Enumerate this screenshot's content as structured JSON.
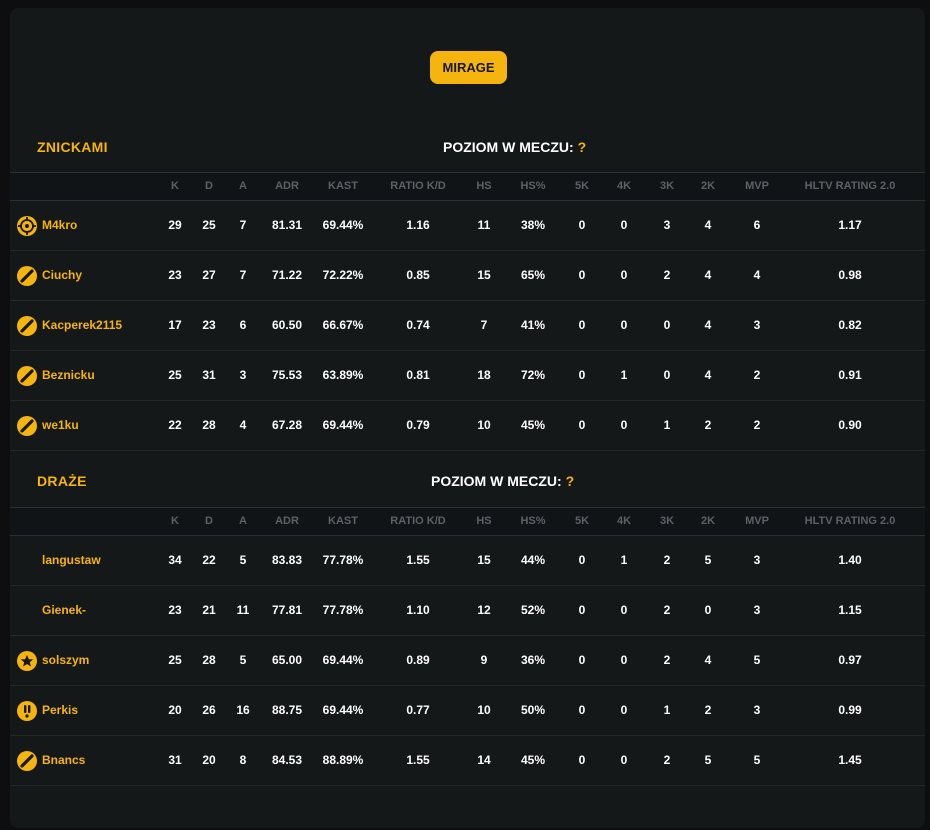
{
  "map": {
    "label": "MIRAGE"
  },
  "columns": [
    "K",
    "D",
    "A",
    "ADR",
    "KAST",
    "RATIO K/D",
    "HS",
    "HS%",
    "5K",
    "4K",
    "3K",
    "2K",
    "MVP",
    "HLTV RATING 2.0"
  ],
  "teams": [
    {
      "name": "ZNICKAMI",
      "level_label": "POZIOM W MECZU:",
      "level_value": "?",
      "players": [
        {
          "name": "M4kro",
          "icon": "crosshair-icon",
          "stats": [
            "29",
            "25",
            "7",
            "81.31",
            "69.44%",
            "1.16",
            "11",
            "38%",
            "0",
            "0",
            "3",
            "4",
            "6",
            "1.17"
          ]
        },
        {
          "name": "Ciuchy",
          "icon": "slash-icon",
          "stats": [
            "23",
            "27",
            "7",
            "71.22",
            "72.22%",
            "0.85",
            "15",
            "65%",
            "0",
            "0",
            "2",
            "4",
            "4",
            "0.98"
          ]
        },
        {
          "name": "Kacperek2115",
          "icon": "slash-icon",
          "stats": [
            "17",
            "23",
            "6",
            "60.50",
            "66.67%",
            "0.74",
            "7",
            "41%",
            "0",
            "0",
            "0",
            "4",
            "3",
            "0.82"
          ]
        },
        {
          "name": "Beznicku",
          "icon": "slash-icon",
          "stats": [
            "25",
            "31",
            "3",
            "75.53",
            "63.89%",
            "0.81",
            "18",
            "72%",
            "0",
            "1",
            "0",
            "4",
            "2",
            "0.91"
          ]
        },
        {
          "name": "we1ku",
          "icon": "slash-icon",
          "stats": [
            "22",
            "28",
            "4",
            "67.28",
            "69.44%",
            "0.79",
            "10",
            "45%",
            "0",
            "0",
            "1",
            "2",
            "2",
            "0.90"
          ]
        }
      ]
    },
    {
      "name": "DRAŻE",
      "level_label": "POZIOM W MECZU:",
      "level_value": "?",
      "players": [
        {
          "name": "langustaw",
          "icon": "",
          "stats": [
            "34",
            "22",
            "5",
            "83.83",
            "77.78%",
            "1.55",
            "15",
            "44%",
            "0",
            "1",
            "2",
            "5",
            "3",
            "1.40"
          ]
        },
        {
          "name": "Gienek-",
          "icon": "",
          "stats": [
            "23",
            "21",
            "11",
            "77.81",
            "77.78%",
            "1.10",
            "12",
            "52%",
            "0",
            "0",
            "2",
            "0",
            "3",
            "1.15"
          ]
        },
        {
          "name": "solszym",
          "icon": "star-icon",
          "stats": [
            "25",
            "28",
            "5",
            "65.00",
            "69.44%",
            "0.89",
            "9",
            "36%",
            "0",
            "0",
            "2",
            "4",
            "5",
            "0.97"
          ]
        },
        {
          "name": "Perkis",
          "icon": "exclaim-icon",
          "stats": [
            "20",
            "26",
            "16",
            "88.75",
            "69.44%",
            "0.77",
            "10",
            "50%",
            "0",
            "0",
            "1",
            "2",
            "3",
            "0.99"
          ]
        },
        {
          "name": "Bnancs",
          "icon": "slash-icon",
          "stats": [
            "31",
            "20",
            "8",
            "84.53",
            "88.89%",
            "1.55",
            "14",
            "45%",
            "0",
            "0",
            "2",
            "5",
            "5",
            "1.45"
          ]
        }
      ]
    }
  ]
}
